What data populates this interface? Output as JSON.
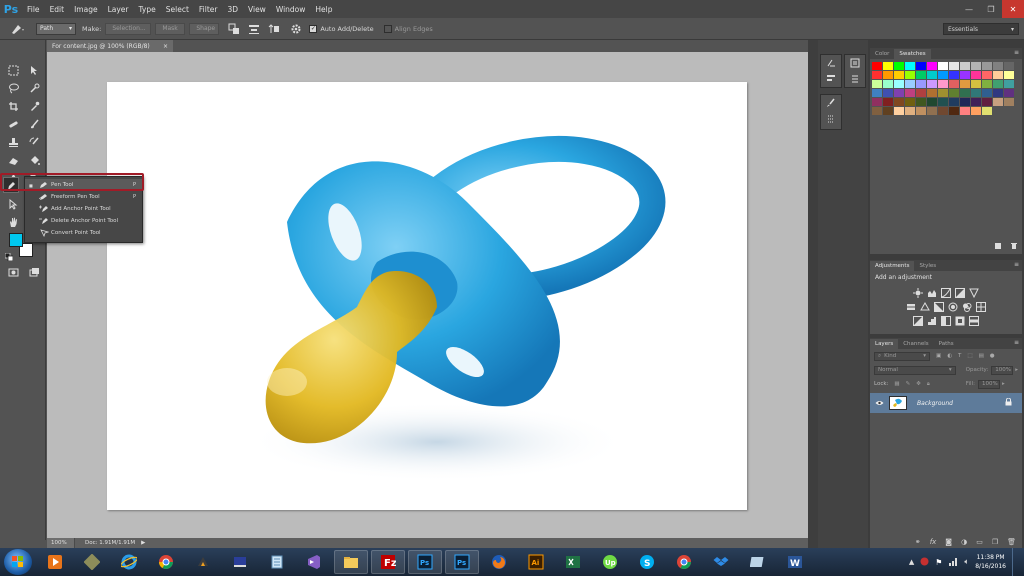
{
  "app": {
    "logo": "Ps"
  },
  "menu": [
    "File",
    "Edit",
    "Image",
    "Layer",
    "Type",
    "Select",
    "Filter",
    "3D",
    "View",
    "Window",
    "Help"
  ],
  "window_controls": {
    "minimize": "—",
    "restore": "❐",
    "close": "✕"
  },
  "options": {
    "mode": "Path",
    "make_label": "Make:",
    "selection_btn": "Selection...",
    "mask_btn": "Mask",
    "shape_btn": "Shape",
    "auto_add_delete": "Auto Add/Delete",
    "align_edges": "Align Edges",
    "workspace": "Essentials"
  },
  "document": {
    "tab_title": "For content.jpg @ 100% (RGB/8)",
    "tab_close": "×",
    "zoom": "100%",
    "doc_info": "Doc: 1.91M/1.91M"
  },
  "flyout": {
    "items": [
      {
        "label": "Pen Tool",
        "key": "P"
      },
      {
        "label": "Freeform Pen Tool",
        "key": "P"
      },
      {
        "label": "Add Anchor Point Tool",
        "key": ""
      },
      {
        "label": "Delete Anchor Point Tool",
        "key": ""
      },
      {
        "label": "Convert Point Tool",
        "key": ""
      }
    ]
  },
  "panels": {
    "swatches_tabs": [
      "Color",
      "Swatches"
    ],
    "adjustments_tabs": [
      "Adjustments",
      "Styles"
    ],
    "adjustments_title": "Add an adjustment",
    "layers_tabs": [
      "Layers",
      "Channels",
      "Paths"
    ],
    "kind_placeholder": "Kind",
    "blend_mode": "Normal",
    "opacity_label": "Opacity:",
    "opacity_value": "100%",
    "lock_label": "Lock:",
    "fill_label": "Fill:",
    "fill_value": "100%",
    "layer_name": "Background"
  },
  "colors": {
    "foreground": "#00c8f0",
    "background": "#ffffff",
    "highlight": "#a11b27",
    "pacifier_blue": "#29a7e0",
    "nipple_yellow": "#e1b51c"
  },
  "swatches": [
    "#ff0000",
    "#ffff00",
    "#00ff00",
    "#00ffff",
    "#0000ff",
    "#ff00ff",
    "#ffffff",
    "#e6e6e6",
    "#cccccc",
    "#b3b3b3",
    "#999999",
    "#808080",
    "#666666",
    "#ff3030",
    "#ff9900",
    "#ffcc00",
    "#99ff00",
    "#00cc66",
    "#00cccc",
    "#0099ff",
    "#3333ff",
    "#9933ff",
    "#ff3399",
    "#ff6666",
    "#ffcc99",
    "#ffff99",
    "#ccff99",
    "#99ffcc",
    "#99ffff",
    "#99ccff",
    "#9999ff",
    "#cc99ff",
    "#ff99cc",
    "#e06060",
    "#e09a40",
    "#d4c040",
    "#80b040",
    "#40a070",
    "#40a0a0",
    "#4080c0",
    "#4050b0",
    "#8040b0",
    "#c04080",
    "#b04040",
    "#b07030",
    "#a09030",
    "#608030",
    "#307050",
    "#307878",
    "#305f90",
    "#303880",
    "#603080",
    "#903060",
    "#802020",
    "#804820",
    "#706010",
    "#405820",
    "#204830",
    "#205050",
    "#203c60",
    "#202858",
    "#402058",
    "#602040",
    "#c8a080",
    "#a08060",
    "#806040",
    "#604020",
    "#ffd0a0",
    "#e0b080",
    "#c09060",
    "#907050",
    "#704830",
    "#502810",
    "#ff8080",
    "#ffa060",
    "#e0e070"
  ],
  "taskbar": {
    "apps": [
      "media-player",
      "usb-tool",
      "internet-explorer",
      "chrome",
      "winamp",
      "book",
      "notepad",
      "visual-studio",
      "file-explorer",
      "filezilla",
      "photoshop-1",
      "photoshop-2",
      "firefox",
      "illustrator",
      "excel",
      "upwork",
      "skype",
      "chrome-2",
      "dropbox",
      "folder-2",
      "word"
    ],
    "time": "11:38 PM",
    "date": "8/16/2016"
  }
}
